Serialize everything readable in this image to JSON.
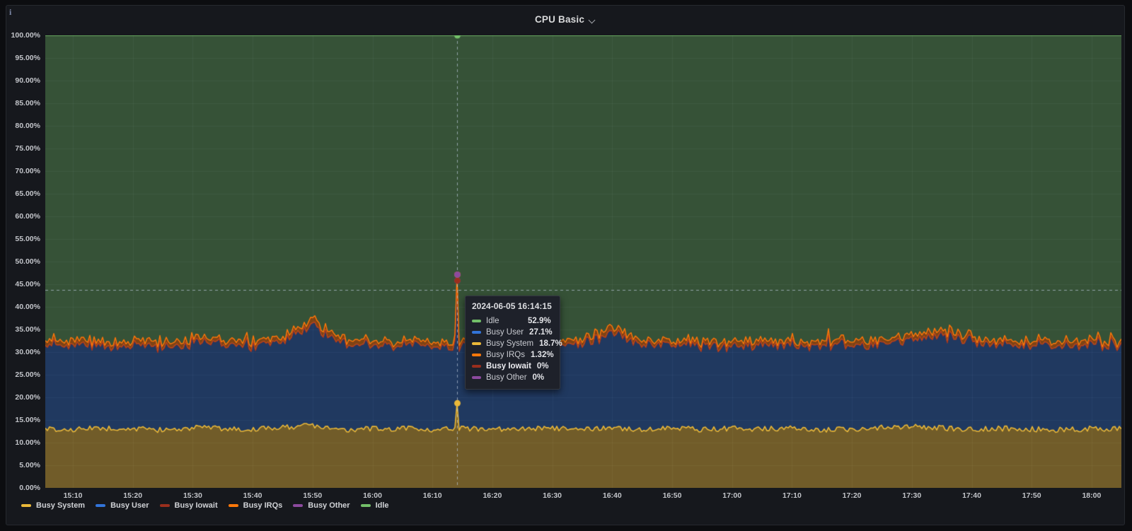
{
  "panel": {
    "title": "CPU Basic"
  },
  "icons": {
    "panel_info_glyph": "i",
    "title_chevron": "chevron-down"
  },
  "colors": {
    "page_bg": "#0c0d10",
    "panel_bg": "#16181d",
    "panel_border": "#26292f",
    "grid": "rgba(205,213,224,0.07)",
    "axis_text": "#c2c4c9",
    "crosshair": "rgba(185,198,215,0.7)",
    "tooltip_bg": "#1e212a"
  },
  "axes": {
    "y_ticks": [
      {
        "v": 0,
        "label": "0.00%"
      },
      {
        "v": 5,
        "label": "5.00%"
      },
      {
        "v": 10,
        "label": "10.00%"
      },
      {
        "v": 15,
        "label": "15.00%"
      },
      {
        "v": 20,
        "label": "20.00%"
      },
      {
        "v": 25,
        "label": "25.00%"
      },
      {
        "v": 30,
        "label": "30.00%"
      },
      {
        "v": 35,
        "label": "35.00%"
      },
      {
        "v": 40,
        "label": "40.00%"
      },
      {
        "v": 45,
        "label": "45.00%"
      },
      {
        "v": 50,
        "label": "50.00%"
      },
      {
        "v": 55,
        "label": "55.00%"
      },
      {
        "v": 60,
        "label": "60.00%"
      },
      {
        "v": 65,
        "label": "65.00%"
      },
      {
        "v": 70,
        "label": "70.00%"
      },
      {
        "v": 75,
        "label": "75.00%"
      },
      {
        "v": 80,
        "label": "80.00%"
      },
      {
        "v": 85,
        "label": "85.00%"
      },
      {
        "v": 90,
        "label": "90.00%"
      },
      {
        "v": 95,
        "label": "95.00%"
      },
      {
        "v": 100,
        "label": "100.00%"
      }
    ],
    "x_ticks": [
      {
        "minute": 910,
        "label": "15:10"
      },
      {
        "minute": 920,
        "label": "15:20"
      },
      {
        "minute": 930,
        "label": "15:30"
      },
      {
        "minute": 940,
        "label": "15:40"
      },
      {
        "minute": 950,
        "label": "15:50"
      },
      {
        "minute": 960,
        "label": "16:00"
      },
      {
        "minute": 970,
        "label": "16:10"
      },
      {
        "minute": 980,
        "label": "16:20"
      },
      {
        "minute": 990,
        "label": "16:30"
      },
      {
        "minute": 1000,
        "label": "16:40"
      },
      {
        "minute": 1010,
        "label": "16:50"
      },
      {
        "minute": 1020,
        "label": "17:00"
      },
      {
        "minute": 1030,
        "label": "17:10"
      },
      {
        "minute": 1040,
        "label": "17:20"
      },
      {
        "minute": 1050,
        "label": "17:30"
      },
      {
        "minute": 1060,
        "label": "17:40"
      },
      {
        "minute": 1070,
        "label": "17:50"
      },
      {
        "minute": 1080,
        "label": "18:00"
      }
    ]
  },
  "legend": {
    "items": [
      {
        "label": "Busy System",
        "color": "#EAB839"
      },
      {
        "label": "Busy User",
        "color": "#3274D9"
      },
      {
        "label": "Busy Iowait",
        "color": "#9a2e1d"
      },
      {
        "label": "Busy IRQs",
        "color": "#FF780A"
      },
      {
        "label": "Busy Other",
        "color": "#8C4A9E"
      },
      {
        "label": "Idle",
        "color": "#73BF69"
      }
    ]
  },
  "tooltip": {
    "timestamp": "2024-06-05 16:14:15",
    "rows": [
      {
        "label": "Idle",
        "value": "52.9%",
        "color": "#73BF69",
        "bold": false
      },
      {
        "label": "Busy User",
        "value": "27.1%",
        "color": "#3274D9",
        "bold": false
      },
      {
        "label": "Busy System",
        "value": "18.7%",
        "color": "#EAB839",
        "bold": false
      },
      {
        "label": "Busy IRQs",
        "value": "1.32%",
        "color": "#FF780A",
        "bold": false
      },
      {
        "label": "Busy Iowait",
        "value": "0%",
        "color": "#9a2e1d",
        "bold": true
      },
      {
        "label": "Busy Other",
        "value": "0%",
        "color": "#8C4A9E",
        "bold": false
      }
    ]
  },
  "chart_data": {
    "type": "area",
    "stacked": true,
    "unit": "percent",
    "title": "CPU Basic",
    "ylim": [
      0,
      100
    ],
    "x_range_minutes": [
      905.4,
      1085
    ],
    "grid": true,
    "legend_position": "bottom",
    "sample_start_minute": 905,
    "sample_step_minutes": 5,
    "series": [
      {
        "name": "Busy System",
        "color": "#EAB839",
        "fill_alpha": 0.43,
        "noise": 1.2,
        "values": [
          13.1,
          12.9,
          13.2,
          13.0,
          12.8,
          13.3,
          13.1,
          12.9,
          13.4,
          13.8,
          12.9,
          13.0,
          13.2,
          12.8,
          13.1,
          13.0,
          12.9,
          13.2,
          13.0,
          13.1,
          12.8,
          13.3,
          12.9,
          13.1,
          13.0,
          13.2,
          12.9,
          13.0,
          13.4,
          13.6,
          13.2,
          12.9,
          13.1,
          13.0,
          12.8,
          13.1,
          13.0
        ]
      },
      {
        "name": "Busy User",
        "color": "#3274D9",
        "fill_alpha": 0.36,
        "noise": 1.8,
        "values": [
          18.3,
          18.5,
          18.2,
          18.6,
          18.4,
          18.3,
          18.7,
          18.4,
          19.0,
          21.5,
          19.3,
          18.5,
          18.4,
          18.6,
          18.3,
          18.5,
          18.4,
          18.2,
          18.8,
          20.8,
          19.0,
          18.4,
          18.5,
          18.3,
          18.6,
          18.4,
          18.5,
          18.7,
          18.4,
          19.2,
          20.5,
          19.6,
          18.5,
          18.6,
          18.4,
          18.3,
          18.5
        ]
      },
      {
        "name": "Busy Iowait",
        "color": "#9a2e1d",
        "fill_alpha": 0.6,
        "noise": 0,
        "values": [
          0,
          0,
          0,
          0,
          0,
          0,
          0,
          0,
          0,
          0,
          0,
          0,
          0,
          0,
          0,
          0,
          0,
          0,
          0,
          0,
          0,
          0,
          0,
          0,
          0,
          0,
          0,
          0,
          0,
          0,
          0,
          0,
          0,
          0,
          0,
          0,
          0
        ]
      },
      {
        "name": "Busy IRQs",
        "color": "#FF780A",
        "fill_alpha": 0.45,
        "noise": 0.5,
        "values": [
          1.0,
          1.1,
          0.9,
          1.0,
          1.1,
          1.0,
          0.9,
          1.1,
          1.0,
          1.3,
          1.1,
          1.0,
          0.9,
          1.0,
          1.1,
          1.0,
          1.0,
          0.9,
          1.1,
          1.2,
          1.0,
          0.9,
          1.0,
          1.1,
          1.0,
          0.9,
          1.0,
          1.1,
          1.0,
          1.1,
          1.2,
          1.0,
          0.9,
          1.0,
          1.1,
          1.0,
          0.9
        ]
      },
      {
        "name": "Busy Other",
        "color": "#8C4A9E",
        "fill_alpha": 0.4,
        "noise": 0,
        "values": [
          0,
          0,
          0,
          0,
          0,
          0,
          0,
          0,
          0,
          0,
          0,
          0,
          0,
          0,
          0,
          0,
          0,
          0,
          0,
          0,
          0,
          0,
          0,
          0,
          0,
          0,
          0,
          0,
          0,
          0,
          0,
          0,
          0,
          0,
          0,
          0,
          0
        ]
      },
      {
        "name": "Idle",
        "color": "#73BF69",
        "fill_alpha": 0.35,
        "noise": 0,
        "values": [
          67.6,
          67.5,
          67.7,
          67.4,
          67.7,
          67.4,
          67.3,
          67.6,
          66.6,
          63.4,
          66.7,
          67.5,
          67.5,
          67.6,
          67.5,
          67.5,
          67.7,
          67.7,
          67.1,
          64.9,
          67.2,
          67.4,
          67.6,
          67.5,
          67.4,
          67.5,
          67.6,
          67.2,
          67.2,
          66.1,
          65.1,
          66.5,
          67.5,
          67.4,
          67.7,
          67.6,
          67.6
        ]
      }
    ],
    "spike": {
      "time": "16:14:15",
      "minute": 974.25,
      "busy_system_top": 18.7,
      "busy_user_top": 45.8,
      "busy_irq_top": 47.12,
      "idle_top": 100
    },
    "crosshair": {
      "time": "16:14:15",
      "minute": 974.25,
      "y_percent": 43.75
    },
    "hover_dots": [
      {
        "series": "Busy User",
        "percent": 45.8,
        "color": "#3274D9"
      },
      {
        "series": "Busy Iowait",
        "percent": 45.8,
        "color": "#9a2e1d"
      },
      {
        "series": "Busy IRQs",
        "percent": 47.12,
        "color": "#FF780A"
      },
      {
        "series": "Busy Other",
        "percent": 47.12,
        "color": "#8C4A9E"
      },
      {
        "series": "Busy System",
        "percent": 18.7,
        "color": "#EAB839"
      },
      {
        "series": "Idle",
        "percent": 100,
        "color": "#73BF69"
      }
    ]
  }
}
